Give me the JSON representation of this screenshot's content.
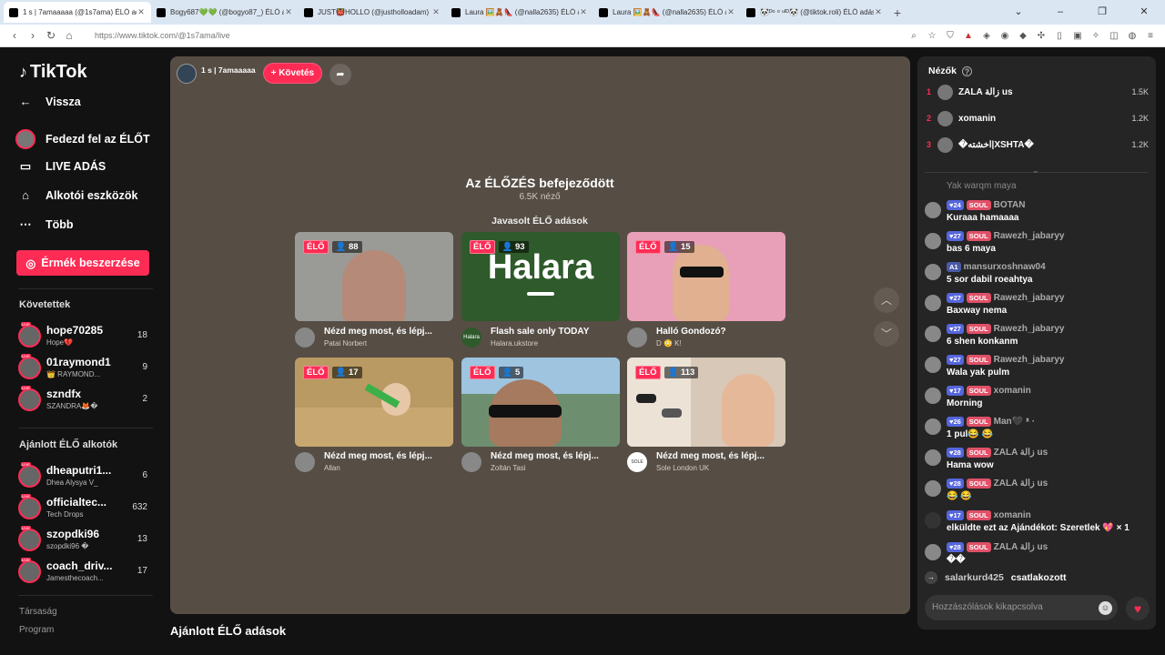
{
  "browser": {
    "tabs": [
      {
        "title": "1 s | 7amaaaaa (@1s7ama) ÉLŐ ad",
        "active": true
      },
      {
        "title": "Bogy687💚💚 (@bogyo87_) ÉLŐ a",
        "active": false
      },
      {
        "title": "JUST👹HOLLO (@justholloadam) ÉL",
        "active": false
      },
      {
        "title": "Laura 🖼️🧸👠 (@nalla2635) ÉLŐ adá",
        "active": false
      },
      {
        "title": "Laura 🖼️🧸👠 (@nalla2635) ÉLŐ adá",
        "active": false
      },
      {
        "title": "🐼ᴰᵒ ᵒ ᵘᴵᴰ🐼 (@tiktok.roli) ÉLŐ adás",
        "active": false
      }
    ],
    "url": "https://www.tiktok.com/@1s7ama/live"
  },
  "sidebar": {
    "logo": "TikTok",
    "back": "Vissza",
    "nav": [
      {
        "label": "Fedezd fel az ÉLŐT",
        "icon": "avatar"
      },
      {
        "label": "LIVE ADÁS",
        "icon": "camera-icon"
      },
      {
        "label": "Alkotói eszközök",
        "icon": "house-icon"
      },
      {
        "label": "Több",
        "icon": "more-icon"
      }
    ],
    "coins_button": "Érmék beszerzése",
    "following_title": "Követettek",
    "following": [
      {
        "name": "hope70285",
        "sub": "Hope💔",
        "count": "18"
      },
      {
        "name": "01raymond1",
        "sub": "👑 RAYMOND...",
        "count": "9"
      },
      {
        "name": "szndfx",
        "sub": "SZANDRA🦊�",
        "count": "2"
      }
    ],
    "recommended_title": "Ajánlott ÉLŐ alkotók",
    "recommended": [
      {
        "name": "dheaputri1...",
        "sub": "Dhea Alysya V_",
        "count": "6"
      },
      {
        "name": "officialtec...",
        "sub": "Tech Drops",
        "count": "632"
      },
      {
        "name": "szopdki96",
        "sub": "szopdki96 �",
        "count": "13"
      },
      {
        "name": "coach_driv...",
        "sub": "Jamesthecoach...",
        "count": "17"
      }
    ],
    "footer": [
      "Társaság",
      "Program"
    ]
  },
  "stream": {
    "host": "1 s | 7amaaaaa",
    "follow_label": "+ Követés",
    "ended_title": "Az ÉLŐZÉS befejeződött",
    "ended_views": "6.5K néző",
    "suggested_title": "Javasolt ÉLŐ adások",
    "live_badge": "ÉLŐ",
    "cards": [
      {
        "viewers": "88",
        "title": "Nézd meg most, és lépj...",
        "user": "Patai Norbert",
        "thumb_color": "#9a9a96"
      },
      {
        "viewers": "93",
        "title": "Flash sale only TODAY",
        "user": "Halara.ukstore",
        "thumb_color": "#2f5a2b",
        "logo_text": "Halara",
        "avatar_text": "Halara"
      },
      {
        "viewers": "15",
        "title": "Halló Gondozó?",
        "user": "D 😳 K!",
        "thumb_color": "#e8a0b8"
      },
      {
        "viewers": "17",
        "title": "Nézd meg most, és lépj...",
        "user": "Allan",
        "thumb_color": "#b89a62"
      },
      {
        "viewers": "5",
        "title": "Nézd meg most, és lépj...",
        "user": "Zoltán Tasi",
        "thumb_color": "#6d8f6f"
      },
      {
        "viewers": "113",
        "title": "Nézd meg most, és lépj...",
        "user": "Sole London UK",
        "thumb_color": "#d8c8b8",
        "avatar_text": "SOLE"
      }
    ],
    "bottom_heading": "Ajánlott ÉLŐ adások"
  },
  "chat": {
    "viewers_title": "Nézők",
    "top_viewers": [
      {
        "rank": "1",
        "name": "ZALA زالة us",
        "count": "1.5K"
      },
      {
        "rank": "2",
        "name": "xomanin",
        "count": "1.2K"
      },
      {
        "rank": "3",
        "name": "�اخشته|XSHTA�",
        "count": "1.2K"
      }
    ],
    "faded_message": "Yak warqm maya",
    "messages": [
      {
        "level": "24",
        "soul": "SOUL",
        "user": "BOTAN",
        "text": "Kuraaa hamaaaa"
      },
      {
        "level": "27",
        "soul": "SOUL",
        "user": "Rawezh_jabaryy",
        "text": "bas 6 maya"
      },
      {
        "level": "1",
        "soul": "",
        "user": "mansurxoshnaw04",
        "text": "5 sor dabil roeahtya"
      },
      {
        "level": "27",
        "soul": "SOUL",
        "user": "Rawezh_jabaryy",
        "text": "Baxway nema"
      },
      {
        "level": "27",
        "soul": "SOUL",
        "user": "Rawezh_jabaryy",
        "text": "6 shen konkanm"
      },
      {
        "level": "27",
        "soul": "SOUL",
        "user": "Rawezh_jabaryy",
        "text": "Wala yak pulm"
      },
      {
        "level": "17",
        "soul": "SOUL",
        "user": "xomanin",
        "text": "Morning"
      },
      {
        "level": "26",
        "soul": "SOUL",
        "user": "Man🖤 ᵜ ·",
        "text": "1 pul😂 😂"
      },
      {
        "level": "28",
        "soul": "SOUL",
        "user": "ZALA زالة us",
        "text": "Hama wow"
      },
      {
        "level": "28",
        "soul": "SOUL",
        "user": "ZALA زالة us",
        "text": "😂 😂"
      },
      {
        "level": "17",
        "soul": "SOUL",
        "user": "xomanin",
        "text": "elküldte ezt az Ajándékot: Szeretlek 💖 × 1"
      },
      {
        "level": "28",
        "soul": "SOUL",
        "user": "ZALA زالة us",
        "text": "��"
      }
    ],
    "join_user": "salarkurd425",
    "join_text": "csatlakozott",
    "input_placeholder": "Hozzászólások kikapcsolva"
  },
  "colors": {
    "accent": "#fe2c55",
    "stage_bg": "#564e45",
    "chat_bg": "#252525"
  }
}
